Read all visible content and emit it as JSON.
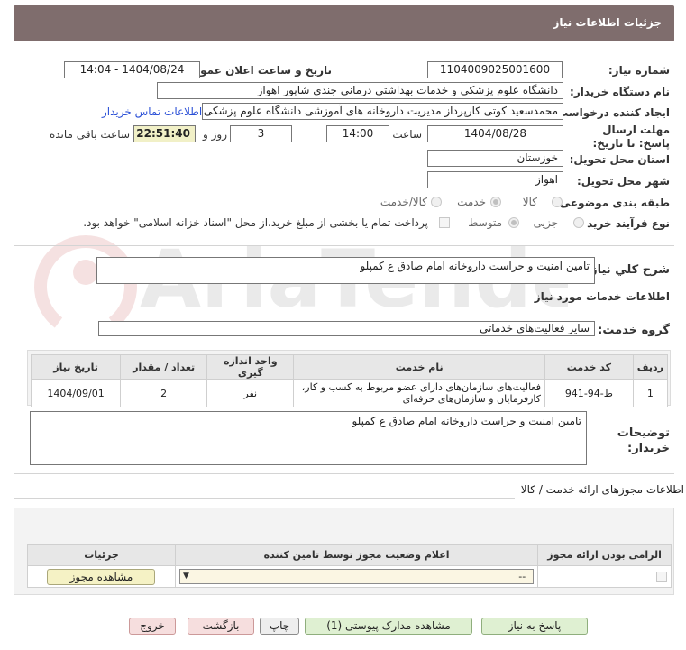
{
  "header": {
    "title": "جزئیات اطلاعات نیاز"
  },
  "labels": {
    "need_number": "شماره نیاز:",
    "announce_datetime": "تاریخ و ساعت اعلان عمومی:",
    "buyer_org": "نام دستگاه خریدار:",
    "requester": "ایجاد کننده درخواست:",
    "deadline": "مهلت ارسال پاسخ: تا تاریخ:",
    "time_word": "ساعت",
    "day_and": "روز و",
    "remaining": "ساعت باقی مانده",
    "province": "استان محل تحویل:",
    "city": "شهر محل تحویل:",
    "category": "طبقه بندی موضوعی:",
    "purchase_type": "نوع فرآیند خرید :",
    "general_desc": "شرح كلي نياز:",
    "services_info": "اطلاعات خدمات مورد نياز",
    "service_group": "گروه خدمت:",
    "buyer_notes": "توضیحات خریدار:"
  },
  "fields": {
    "need_number": "1104009025001600",
    "announce_datetime": "1404/08/24 - 14:04",
    "buyer_org": "دانشگاه علوم پزشکی و خدمات بهداشتی درمانی جندی شاپور اهواز",
    "requester": "محمدسعید کوتی کارپرداز مدیریت داروخانه های آموزشی دانشگاه علوم پزشکی",
    "contact_link": "اطلاعات تماس خریدار",
    "deadline_date": "1404/08/28",
    "deadline_time": "14:00",
    "days": "3",
    "remaining_time": "22:51:40",
    "province": "خوزستان",
    "city": "اهواز",
    "general_desc": "تامین امنیت و حراست داروخانه امام صادق ع کمپلو",
    "service_group": "سایر فعالیت‌های خدماتی",
    "buyer_notes": "تامین امنیت و حراست داروخانه امام صادق ع کمپلو"
  },
  "category_options": {
    "goods": "کالا",
    "service": "خدمت",
    "goods_service": "کالا/خدمت"
  },
  "purchase_options": {
    "partial": "جزیی",
    "medium": "متوسط",
    "treasury_note": "پرداخت تمام یا بخشی از مبلغ خرید،از محل \"اسناد خزانه اسلامی\" خواهد بود."
  },
  "service_table": {
    "headers": [
      "ردیف",
      "کد خدمت",
      "نام خدمت",
      "واحد اندازه گیری",
      "تعداد / مقدار",
      "تاریخ نیاز"
    ],
    "rows": [
      [
        "1",
        "ط-94-941",
        "فعالیت‌های سازمان‌های دارای عضو مربوط به کسب و کار، کارفرمایان و سازمان‌های حرفه‌ای",
        "نفر",
        "2",
        "1404/09/01"
      ]
    ]
  },
  "permits": {
    "section_title": "اطلاعات مجوزهای ارائه خدمت / کالا",
    "headers": [
      "الزامی بودن ارائه مجوز",
      "اعلام وضعیت مجوز توسط تامین کننده",
      "جزئیات"
    ],
    "select_value": "--",
    "view_button": "مشاهده مجوز"
  },
  "buttons": {
    "reply": "پاسخ به نیاز",
    "attachments": "مشاهده مدارک پیوستی (1)",
    "print": "چاپ",
    "back": "بازگشت",
    "exit": "خروج"
  },
  "colors": {
    "header_bg": "#7f6d6d",
    "link": "#2a4fd6",
    "timer_bg": "#f1f0c7"
  }
}
